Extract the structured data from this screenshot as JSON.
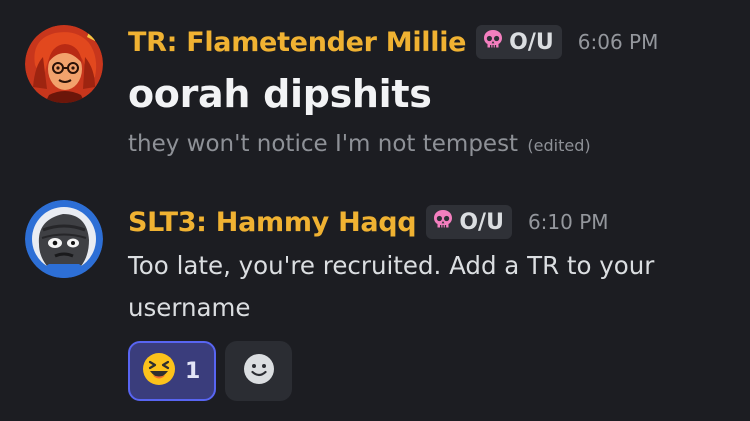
{
  "messages": [
    {
      "username": "TR: Flametender Millie",
      "role_tag": "O/U",
      "timestamp": "6:06 PM",
      "lines": [
        {
          "text": "oorah dipshits",
          "style": "big"
        },
        {
          "text": "they won't notice I'm not tempest",
          "style": "muted",
          "edited": "(edited)"
        }
      ]
    },
    {
      "username": "SLT3: Hammy Haqq",
      "role_tag": "O/U",
      "timestamp": "6:10 PM",
      "lines": [
        {
          "text": "Too late, you're recruited. Add a TR to your username",
          "style": "normal"
        }
      ],
      "reactions": [
        {
          "emoji": "laughing-face",
          "count": "1",
          "active": true
        }
      ]
    }
  ],
  "icons": {
    "role_tag": "skull-icon",
    "add_reaction": "smiley-icon"
  },
  "colors": {
    "background": "#1c1d22",
    "username": "#f0b232",
    "role_tag_bg": "#2f3137",
    "skull": "#f47fbf",
    "reaction_active_bg": "#3a3d7c",
    "reaction_active_border": "#5865f2"
  }
}
